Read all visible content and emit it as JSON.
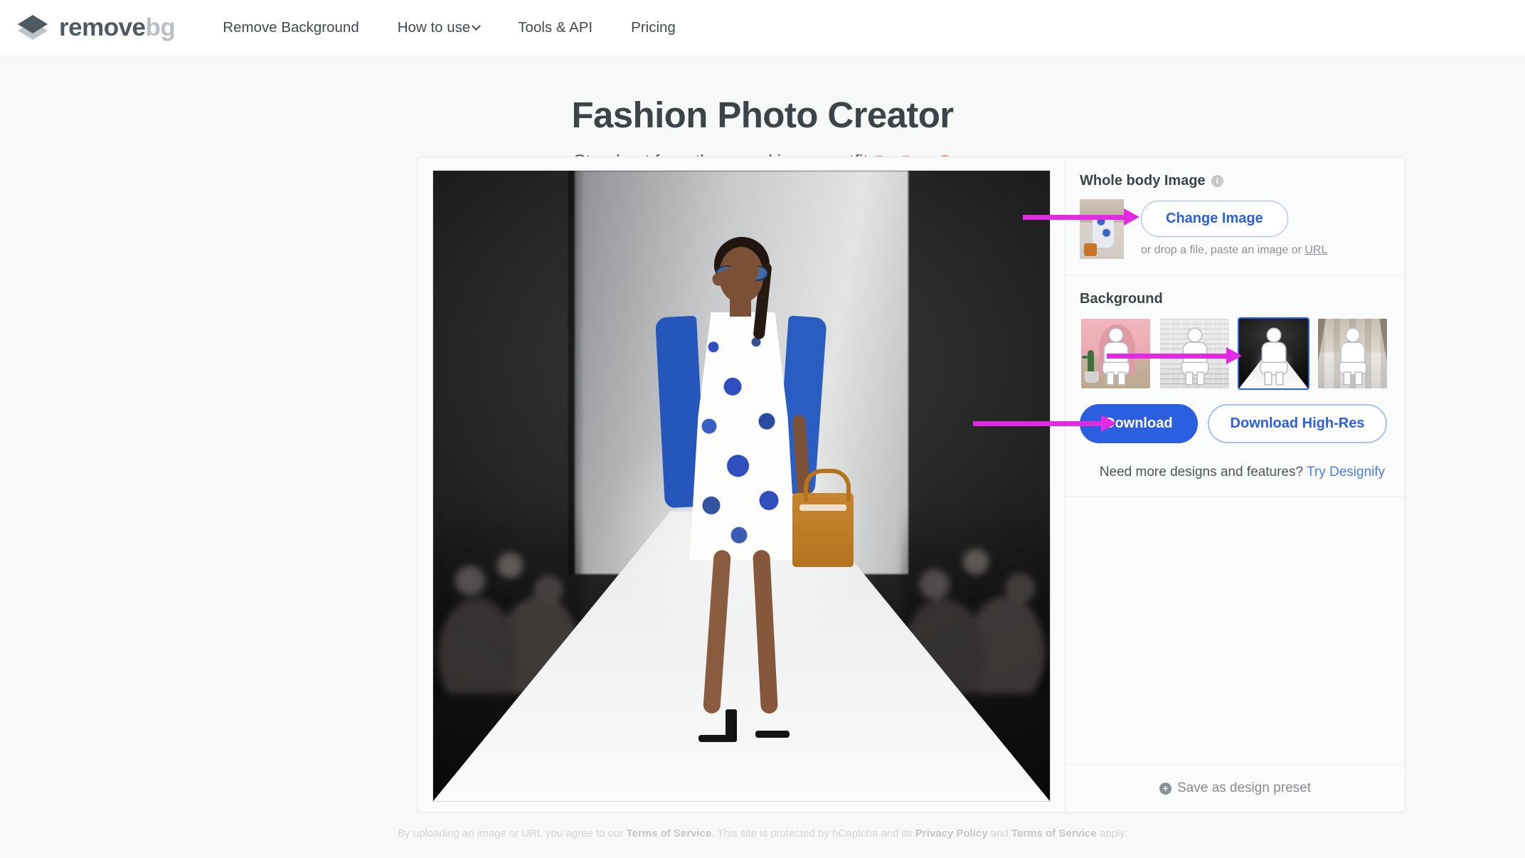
{
  "nav": {
    "logo": {
      "name_bold": "remove",
      "name_light": "bg"
    },
    "links": [
      {
        "label": "Remove Background",
        "has_caret": false
      },
      {
        "label": "How to use",
        "has_caret": true
      },
      {
        "label": "Tools & API",
        "has_caret": false
      },
      {
        "label": "Pricing",
        "has_caret": false
      }
    ]
  },
  "hero": {
    "title": "Fashion Photo Creator",
    "subtitle": "Stand out from the crowd in any outfit",
    "badge": "For Free",
    "info_glyph": "i"
  },
  "panel": {
    "upload": {
      "title": "Whole body Image",
      "info_glyph": "i",
      "change_button": "Change Image",
      "hint_pre": "or drop a file, paste an image or ",
      "hint_link": "URL"
    },
    "background": {
      "title": "Background",
      "options": [
        {
          "name": "pink-room",
          "selected": false
        },
        {
          "name": "white-brick-wall",
          "selected": false
        },
        {
          "name": "dark-runway",
          "selected": true
        },
        {
          "name": "industrial-corridor",
          "selected": false
        }
      ]
    },
    "download": {
      "primary": "Download",
      "secondary": "Download High-Res"
    },
    "designify": {
      "text": "Need more designs and features? ",
      "link": "Try Designify"
    },
    "preset": {
      "label": "Save as design preset",
      "icon_glyph": "+"
    }
  },
  "footer": {
    "p1": "By uploading an image or URL you agree to our ",
    "b1": "Terms of Service",
    "p2": ". This site is protected by hCaptcha and its ",
    "b2": "Privacy Policy",
    "p3": " and ",
    "b3": "Terms of Service",
    "p4": " apply."
  },
  "colors": {
    "accent_blue": "#2b5fe0",
    "badge_salmon": "#f08a84",
    "arrow_magenta": "#e32ae3",
    "logo_dark": "#4e5a61"
  }
}
